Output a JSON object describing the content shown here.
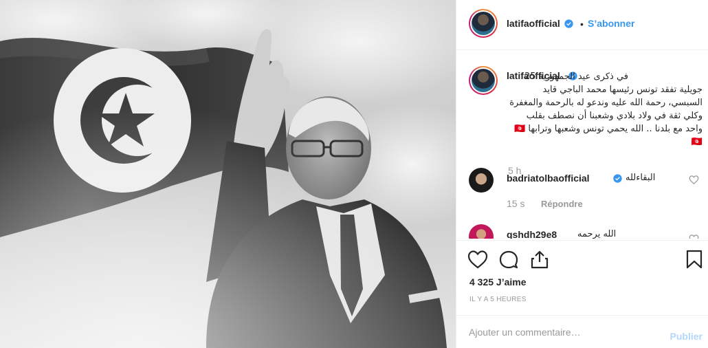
{
  "post": {
    "author": "latifaofficial",
    "follow_label": "S’abonner",
    "separator": "•",
    "caption": "في ذكرى عيد الجمهورية 25 جويلية تفقد تونس رئيسها محمد الباجي قايد السبسي، رحمة الله عليه وندعو له بالرحمة والمغفرة وكلي ثقة في ولاد بلادي وشعبنا أن نصطف بقلب واحد مع بلدنا .. الله يحمي تونس وشعبها وترابها 🇹🇳🇹🇳",
    "caption_time": "5 h",
    "likes": "4 325 J’aime",
    "posted_ago": "IL Y A 5 HEURES"
  },
  "comments": [
    {
      "user": "badriatolbaofficial",
      "verified": true,
      "text": "البقاءلله",
      "time": "15 s",
      "reply_label": "Répondre"
    },
    {
      "user": "qshdh29e8",
      "verified": false,
      "text": "الله يرحمه"
    }
  ],
  "composer": {
    "placeholder": "Ajouter un commentaire…",
    "post_label": "Publier"
  },
  "icons": {
    "verified": "verified-badge-icon",
    "like": "heart-icon",
    "comment": "comment-icon",
    "share": "share-icon",
    "save": "bookmark-icon"
  },
  "colors": {
    "accent": "#3897f0",
    "muted": "#999999",
    "post_disabled": "#b3d7fb"
  }
}
